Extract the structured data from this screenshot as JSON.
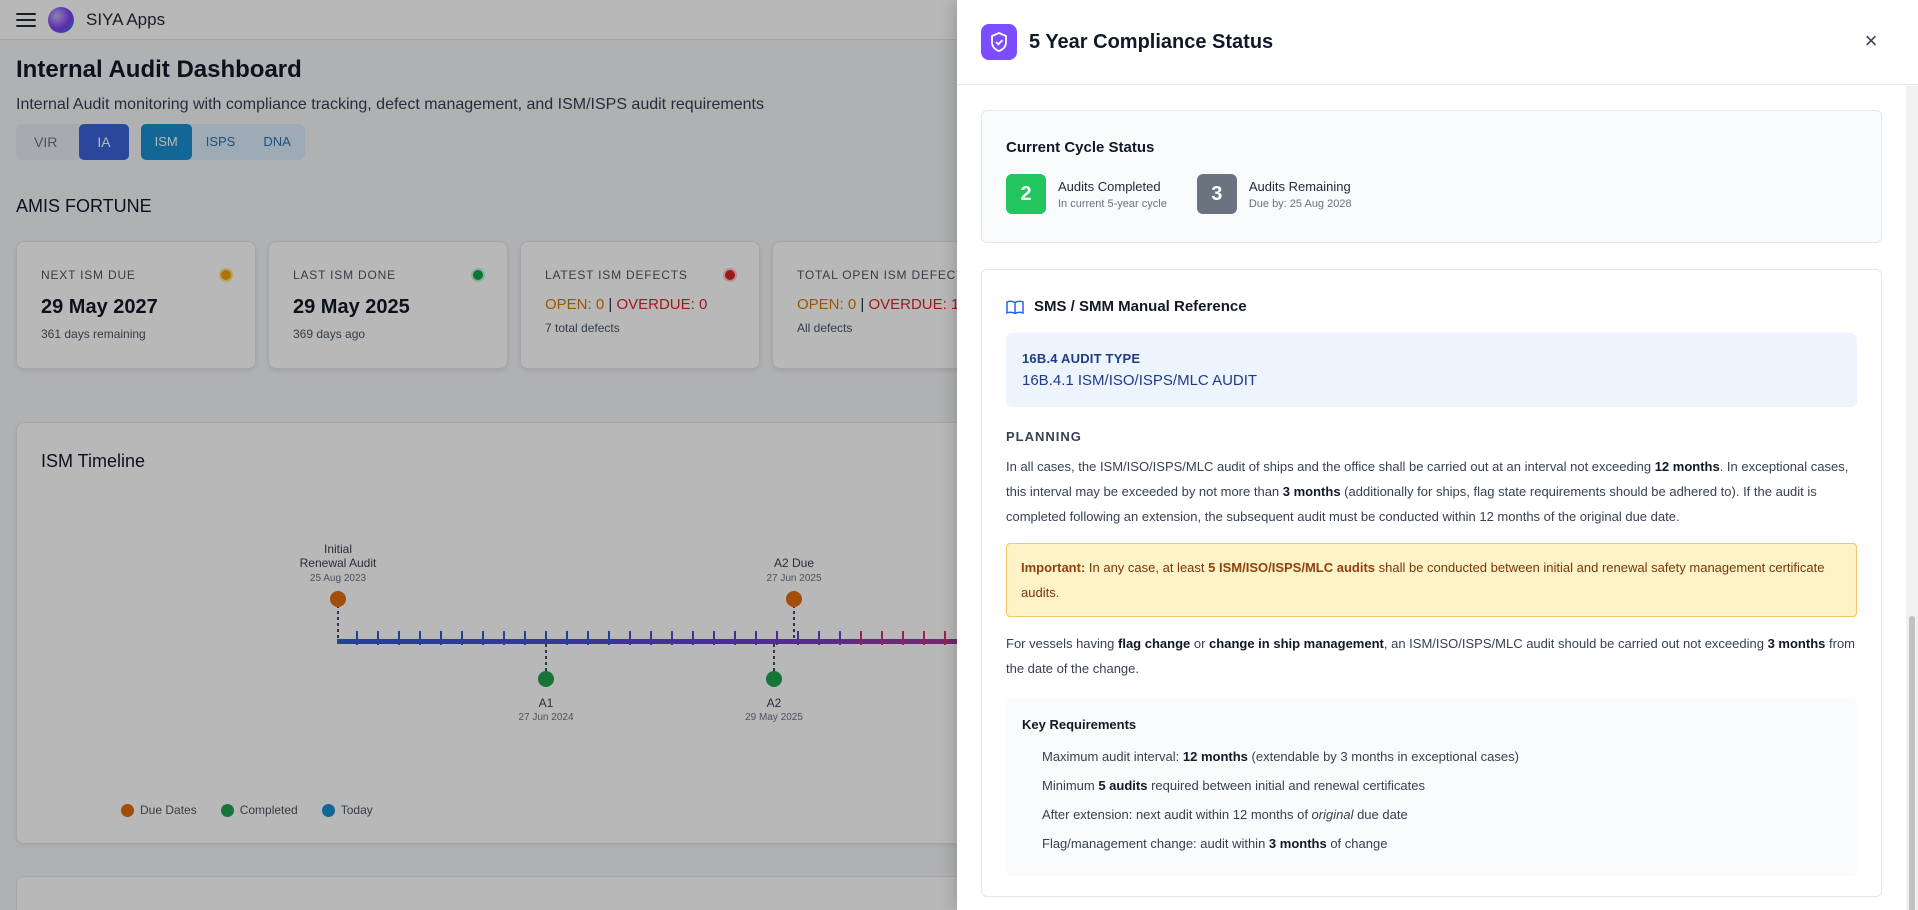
{
  "topbar": {
    "brand": "SIYA Apps"
  },
  "page": {
    "title": "Internal Audit Dashboard",
    "subtitle": "Internal Audit monitoring with compliance tracking, defect management, and ISM/ISPS audit requirements",
    "tabs_primary": [
      "VIR",
      "IA"
    ],
    "tabs_secondary": [
      "ISM",
      "ISPS",
      "DNA"
    ],
    "vessel": "AMIS FORTUNE"
  },
  "cards": [
    {
      "label": "NEXT ISM DUE",
      "value": "29 May 2027",
      "note": "361 days remaining"
    },
    {
      "label": "LAST ISM DONE",
      "value": "29 May 2025",
      "note": "369 days ago"
    },
    {
      "label": "LATEST ISM DEFECTS",
      "open": "OPEN: 0",
      "sep": "|",
      "overdue": "OVERDUE: 0",
      "note": "7 total defects"
    },
    {
      "label": "TOTAL OPEN ISM DEFECTS",
      "open": "OPEN: 0",
      "sep": "|",
      "overdue": "OVERDUE: 1",
      "note": "All defects"
    }
  ],
  "timeline": {
    "title": "ISM Timeline",
    "points": [
      {
        "label1": "Initial",
        "label2": "Renewal Audit",
        "date": "25 Aug 2023"
      },
      {
        "label1": "A2 Due",
        "date": "27 Jun 2025"
      },
      {
        "label1": "A1",
        "date": "27 Jun 2024"
      },
      {
        "label1": "A2",
        "date": "29 May 2025"
      }
    ],
    "legend": [
      "Due Dates",
      "Completed",
      "Today"
    ]
  },
  "colors": {
    "due": "#e06c10",
    "completed": "#22a04b",
    "today": "#1a8fd0",
    "accent": "#7c4dff"
  },
  "drawer": {
    "title": "5 Year Compliance Status",
    "cycle": {
      "title": "Current Cycle Status",
      "completed_count": "2",
      "completed_label": "Audits Completed",
      "completed_sub": "In current 5-year cycle",
      "remaining_count": "3",
      "remaining_label": "Audits Remaining",
      "remaining_sub": "Due by: 25 Aug 2028"
    },
    "reference": {
      "title": "SMS / SMM Manual Reference",
      "type_key": "16B.4 AUDIT TYPE",
      "type_value": "16B.4.1 ISM/ISO/ISPS/MLC AUDIT",
      "planning": "PLANNING",
      "p1_a": "In all cases, the ISM/ISO/ISPS/MLC audit of ships and the office shall be carried out at an interval not exceeding ",
      "p1_b": "12 months",
      "p1_c": ". In exceptional cases, this interval may be exceeded by not more than ",
      "p1_d": "3 months",
      "p1_e": " (additionally for ships, flag state requirements should be adhered to). If the audit is completed following an extension, the subsequent audit must be conducted within 12 months of the original due date.",
      "imp_a": "Important:",
      "imp_b": " In any case, at least ",
      "imp_c": "5 ISM/ISO/ISPS/MLC audits",
      "imp_d": " shall be conducted between initial and renewal safety management certificate audits.",
      "p2_a": "For vessels having ",
      "p2_b": "flag change",
      "p2_c": " or ",
      "p2_d": "change in ship management",
      "p2_e": ", an ISM/ISO/ISPS/MLC audit should be carried out not exceeding ",
      "p2_f": "3 months",
      "p2_g": " from the date of the change.",
      "key_title": "Key Requirements",
      "req1_a": "Maximum audit interval: ",
      "req1_b": "12 months",
      "req1_c": " (extendable by 3 months in exceptional cases)",
      "req2_a": "Minimum ",
      "req2_b": "5 audits",
      "req2_c": " required between initial and renewal certificates",
      "req3_a": "After extension: next audit within 12 months of ",
      "req3_b": "original",
      "req3_c": " due date",
      "req4_a": "Flag/management change: audit within ",
      "req4_b": "3 months",
      "req4_c": " of change"
    }
  }
}
